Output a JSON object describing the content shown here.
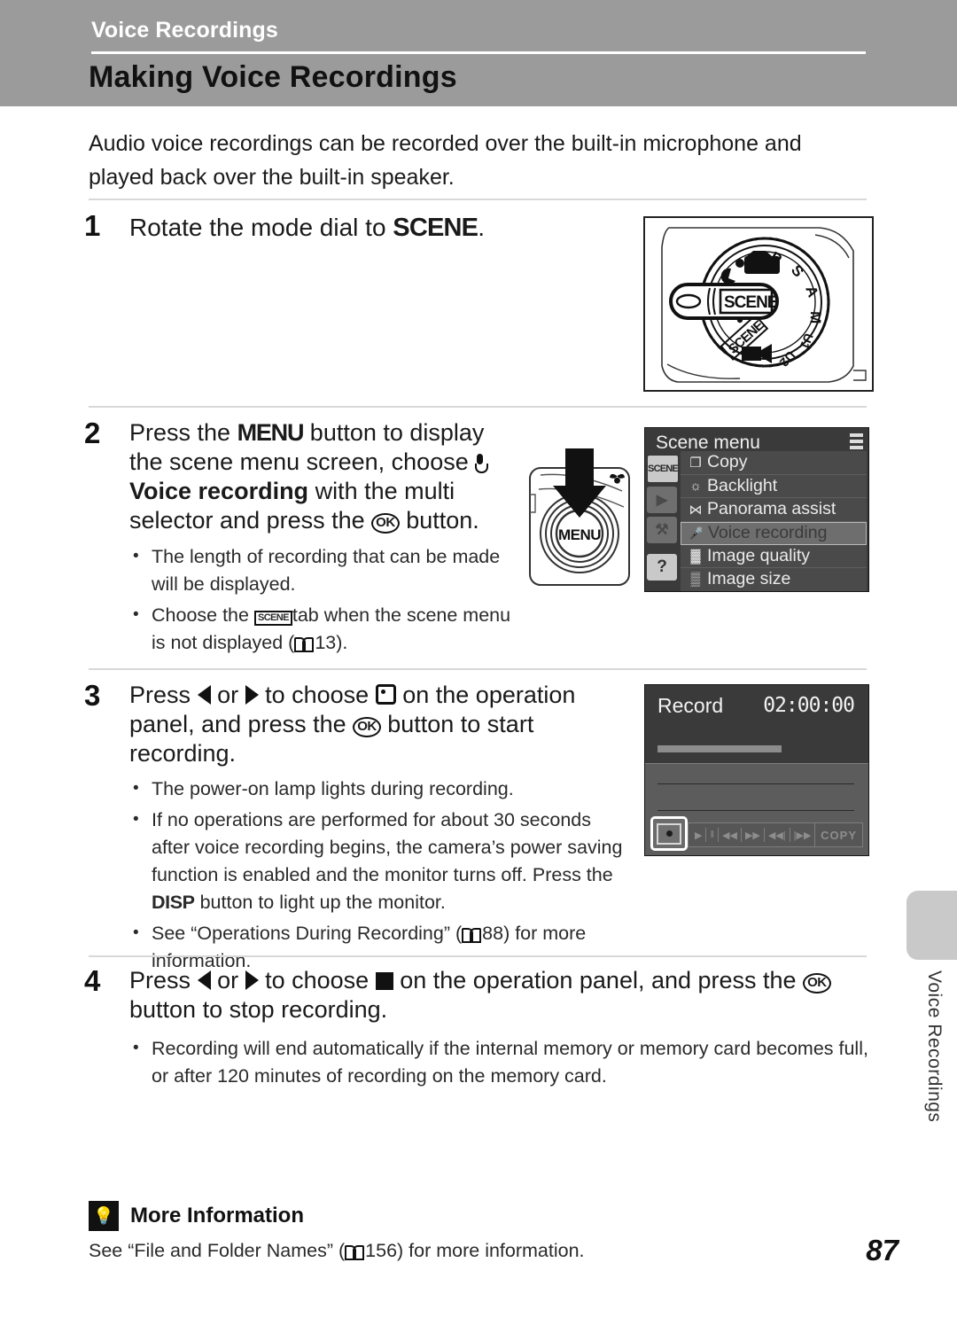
{
  "header": {
    "running_title": "Voice Recordings",
    "title": "Making Voice Recordings"
  },
  "intro": "Audio voice recordings can be recorded over the built-in microphone and played back over the built-in speaker.",
  "steps": [
    {
      "number": "1",
      "text_parts": [
        "Rotate the mode dial to ",
        "SCENE",
        "."
      ],
      "bullets": []
    },
    {
      "number": "2",
      "text_parts": [
        "Press the ",
        "MENU",
        " button to display the scene menu screen, choose ",
        "Voice recording",
        " with the multi selector and press the ",
        "OK",
        " button."
      ],
      "bullets": [
        "The length of recording that can be made will be displayed.",
        "Choose the SCENE tab when the scene menu is not displayed (13)."
      ],
      "bullet_refs": [
        "",
        "13"
      ]
    },
    {
      "number": "3",
      "text_parts": [
        "Press ",
        "left",
        " or ",
        "right",
        " to choose ",
        "record",
        " on the operation panel, and press the ",
        "OK",
        " button to start recording."
      ],
      "bullets": [
        "The power-on lamp lights during recording.",
        "If no operations are performed for about 30 seconds after voice recording begins, the camera's power saving function is enabled and the monitor turns off. Press the DISP button to light up the monitor.",
        "See “Operations During Recording” (88) for more information."
      ],
      "bullet_refs": [
        "",
        "",
        "88"
      ]
    },
    {
      "number": "4",
      "text_parts": [
        "Press ",
        "left",
        " or ",
        "right",
        " to choose ",
        "stop",
        " on the operation panel, and press the ",
        "OK",
        " button to stop recording."
      ],
      "bullets": [
        "Recording will end automatically if the internal memory or memory card becomes full, or after 120 minutes of recording on the memory card."
      ],
      "bullet_refs": [
        ""
      ]
    }
  ],
  "step1_labels": {
    "lead": "Rotate the mode dial to",
    "bold": "SCENE",
    "period": "."
  },
  "step2_labels": {
    "t1": "Press the",
    "menu": "MENU",
    "t2": "button to display the scene menu screen, choose",
    "bold_item": "Voice recording",
    "t3": "with the multi selector and press the",
    "t4": "button.",
    "bullet1": "The length of recording that can be made will be displayed.",
    "bullet2a": "Choose the",
    "scene_tab": "SCENE",
    "bullet2b": "tab when the scene menu is not displayed (",
    "bullet2_ref": "13",
    "bullet2c": ")."
  },
  "step3_labels": {
    "t1": "Press",
    "t2": "or",
    "t3": "to choose",
    "t4": "on the operation",
    "t5": "panel, and press the",
    "t6": "button to start",
    "t7": "recording.",
    "bullet1": "The power-on lamp lights during recording.",
    "bullet2a": "If no operations are performed for about 30 seconds after voice recording begins, the camera’s power saving function is enabled and the monitor turns off. Press the",
    "disp": "DISP",
    "bullet2b": "button to light up the monitor.",
    "bullet3a": "See “Operations During Recording” (",
    "bullet3_ref": "88",
    "bullet3b": ") for more information."
  },
  "step4_labels": {
    "t1": "Press",
    "t2": "or",
    "t3": "to choose",
    "t4": "on the operation panel, and press the",
    "t5": "button to stop recording.",
    "bullet1": "Recording will end automatically if the internal memory or memory card becomes full, or after 120 minutes of recording on the memory card."
  },
  "mode_dial": {
    "callout_label": "SCENE",
    "positions": [
      "P",
      "S",
      "A",
      "M",
      "U1",
      "U2",
      "SCENE"
    ],
    "dial_scene_text": "SCENE"
  },
  "menu_button_illustration": {
    "label": "MENU"
  },
  "scene_menu_screen": {
    "title": "Scene menu",
    "tabs": [
      {
        "name": "scene-tab",
        "glyph": "SCENE",
        "selected": true
      },
      {
        "name": "playback-tab",
        "glyph": "▶",
        "selected": false
      },
      {
        "name": "setup-tab",
        "glyph": "⚒",
        "selected": false
      },
      {
        "name": "help-tab",
        "glyph": "?",
        "selected": false
      }
    ],
    "items": [
      {
        "label": "Copy",
        "icon": "copy-icon",
        "glyph": "❐",
        "selected": false
      },
      {
        "label": "Backlight",
        "icon": "backlight-icon",
        "glyph": "☼",
        "selected": false
      },
      {
        "label": "Panorama assist",
        "icon": "panorama-icon",
        "glyph": "⋈",
        "selected": false
      },
      {
        "label": "Voice recording",
        "icon": "microphone-icon",
        "glyph": "⬤",
        "selected": true
      },
      {
        "label": "Image quality",
        "icon": "image-quality-icon",
        "glyph": "▓",
        "selected": false
      },
      {
        "label": "Image size",
        "icon": "image-size-icon",
        "glyph": "▒",
        "selected": false
      }
    ]
  },
  "record_screen": {
    "title": "Record",
    "time": "02:00:00",
    "panel_buttons": [
      "▶",
      "‖",
      "◀◀",
      "▶▶",
      "◀◀|",
      "|▶▶"
    ],
    "copy_label": "COPY"
  },
  "more_information": {
    "title": "More Information",
    "icon": "lightbulb-icon",
    "body_a": "See “File and Folder Names” (",
    "body_ref": "156",
    "body_b": ") for more information."
  },
  "side_tab": {
    "label": "Voice Recordings"
  },
  "page_number": "87",
  "colors": {
    "header_band": "#9b9b9b",
    "rule": "#d8d8d8",
    "lcd_bg": "#3a3a3a",
    "lcd_selected": "#6e6e6e",
    "side_tab": "#c9c9c9"
  }
}
